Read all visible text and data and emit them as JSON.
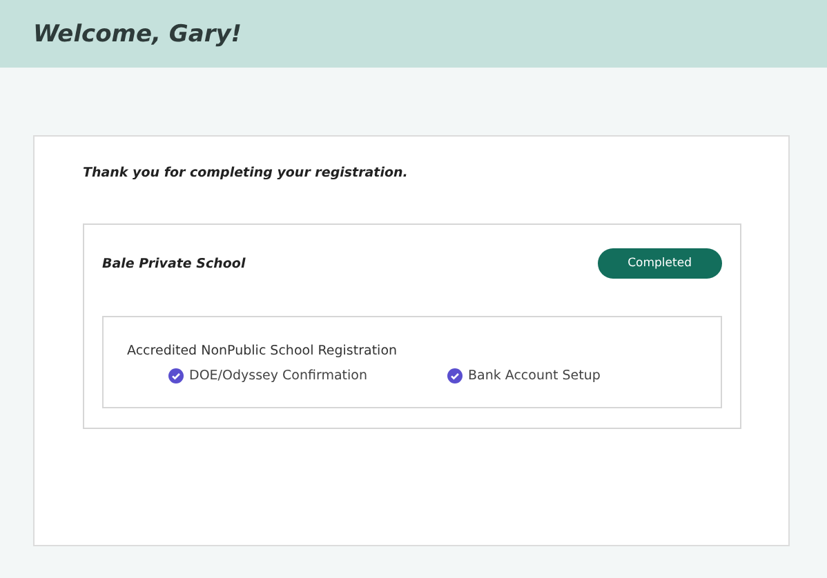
{
  "header": {
    "title": "Welcome, Gary!"
  },
  "message": "Thank you for completing your registration.",
  "school": {
    "name": "Bale Private School",
    "status": "Completed",
    "program": {
      "title": "Accredited NonPublic School Registration",
      "steps": [
        {
          "label": "DOE/Odyssey Confirmation",
          "checked": true
        },
        {
          "label": "Bank Account Setup",
          "checked": true
        }
      ]
    }
  }
}
